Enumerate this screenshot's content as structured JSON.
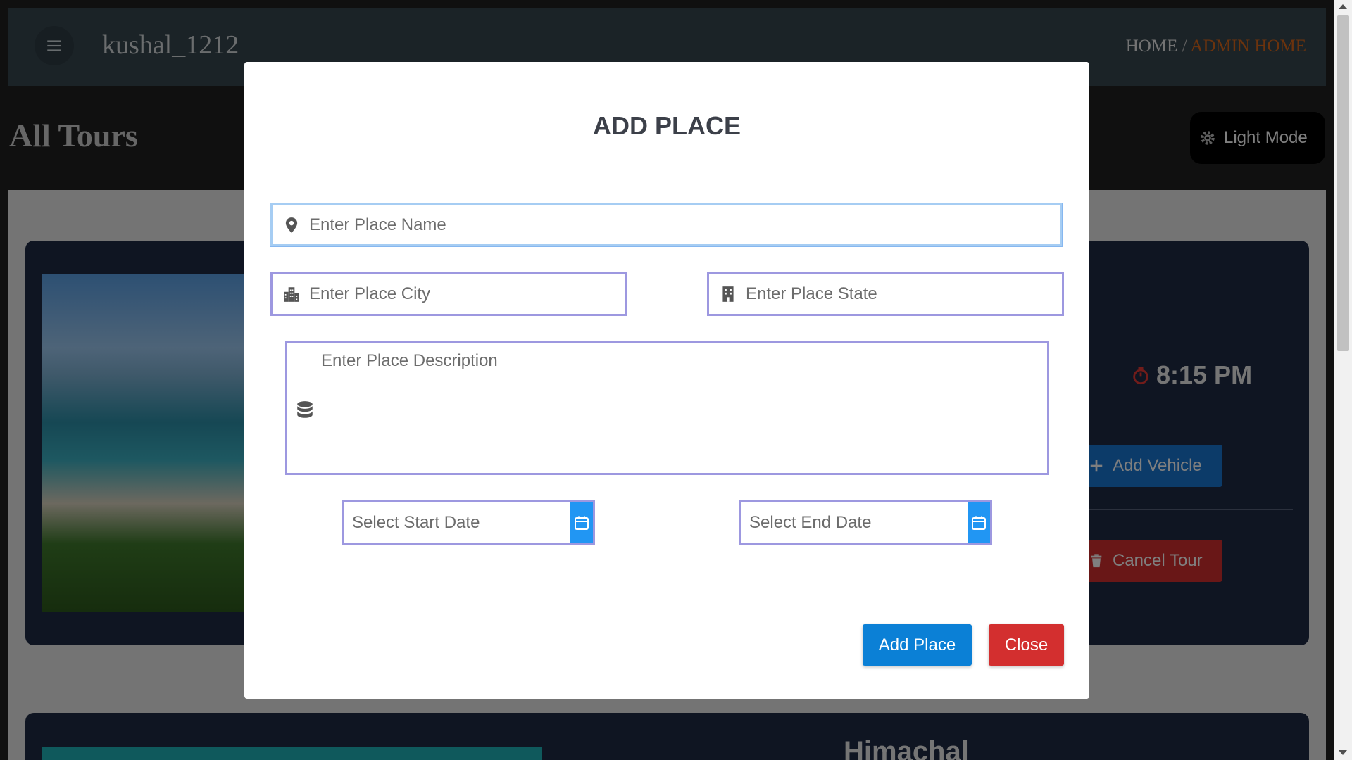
{
  "navbar": {
    "username": "kushal_1212",
    "breadcrumb_home": "HOME",
    "breadcrumb_separator": " / ",
    "breadcrumb_current": "ADMIN HOME",
    "accent_color": "#d9661a"
  },
  "page": {
    "title": "All Tours",
    "mode_button_label": "Light Mode"
  },
  "tour_card": {
    "time": "8:15 PM",
    "add_vehicle_label": "Add Vehicle",
    "cancel_tour_label": "Cancel Tour"
  },
  "tour_card_2": {
    "title": "Himachal"
  },
  "modal": {
    "title": "ADD PLACE",
    "place_name_placeholder": "Enter Place Name",
    "place_city_placeholder": "Enter Place City",
    "place_state_placeholder": "Enter Place State",
    "place_description_placeholder": "Enter Place Description",
    "start_date_placeholder": "Select Start Date",
    "end_date_placeholder": "Select End Date",
    "add_button_label": "Add Place",
    "close_button_label": "Close"
  },
  "colors": {
    "primary": "#0b80d6",
    "danger": "#d32f2f",
    "field_border": "#9d98e0",
    "calendar_button": "#2196f3"
  },
  "icons": {
    "place_name": "map-pin-icon",
    "place_city": "city-icon",
    "place_state": "building-icon",
    "place_description": "database-icon",
    "date": "calendar-icon"
  }
}
